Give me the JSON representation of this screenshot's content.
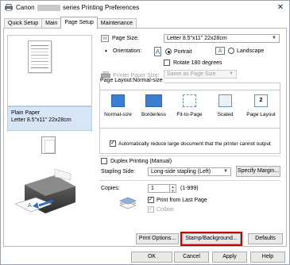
{
  "window": {
    "title_prefix": "Canon",
    "title_suffix": "series Printing Preferences",
    "close_glyph": "✕"
  },
  "tabs": [
    {
      "label": "Quick Setup"
    },
    {
      "label": "Main"
    },
    {
      "label": "Page Setup"
    },
    {
      "label": "Maintenance"
    }
  ],
  "preview": {
    "media_line1": "Plain Paper",
    "media_line2": "Letter 8.5\"x11\" 22x28cm"
  },
  "page_size": {
    "label": "Page Size:",
    "value": "Letter 8.5\"x11\" 22x28cm"
  },
  "orientation": {
    "label": "Orientation:",
    "portrait_label": "Portrait",
    "landscape_label": "Landscape",
    "portrait_icon_glyph": "A",
    "landscape_icon_glyph": "A"
  },
  "rotate": {
    "label": "Rotate 180 degrees"
  },
  "printer_paper_size": {
    "label": "Printer Paper Size:",
    "value": "Same as Page Size"
  },
  "page_layout": {
    "title": "Page Layout:Normal-size",
    "items": [
      {
        "label": "Normal-size",
        "thumb_text": ""
      },
      {
        "label": "Borderless",
        "thumb_text": ""
      },
      {
        "label": "Fit-to-Page",
        "thumb_text": ""
      },
      {
        "label": "Scaled",
        "thumb_text": ""
      },
      {
        "label": "Page Layout",
        "thumb_text": "2"
      }
    ]
  },
  "auto_reduce": {
    "label": "Automatically reduce large document that the printer cannot output"
  },
  "duplex": {
    "label": "Duplex Printing (Manual)"
  },
  "stapling": {
    "label": "Stapling Side:",
    "value": "Long-side stapling (Left)",
    "specify_margin_label": "Specify Margin..."
  },
  "copies": {
    "label": "Copies:",
    "value": "1",
    "range": "(1-999)",
    "print_from_last_label": "Print from Last Page",
    "collate_label": "Collate"
  },
  "bottom_buttons": {
    "print_options": "Print Options...",
    "stamp_background": "Stamp/Background...",
    "defaults": "Defaults"
  },
  "dialog_buttons": {
    "ok": "OK",
    "cancel": "Cancel",
    "apply": "Apply",
    "help": "Help"
  },
  "colors": {
    "accent": "#3b7fd2",
    "highlight_outline": "#d10000",
    "info_bg": "#d7e6f6"
  }
}
